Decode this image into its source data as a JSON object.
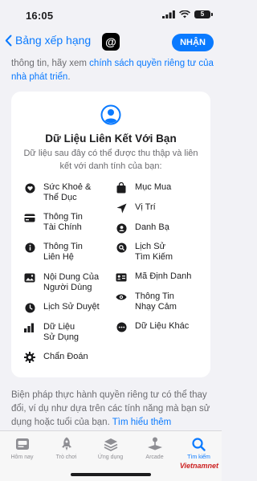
{
  "status": {
    "time": "16:05",
    "battery": "5"
  },
  "nav": {
    "back_label": "Bảng xếp hạng",
    "app_icon_glyph": "@",
    "open_label": "NHẬN"
  },
  "intro": {
    "text": "thông tin, hãy xem ",
    "link": "chính sách quyền riêng tư của nhà phát triển",
    "end": "."
  },
  "card": {
    "title": "Dữ Liệu Liên Kết Với Bạn",
    "subtitle": "Dữ liệu sau đây có thể được thu thập và liên kết với danh tính của bạn:",
    "left_items": [
      {
        "icon": "heart-icon",
        "label": "Sức Khoẻ &\nThể Dục"
      },
      {
        "icon": "credit-card-icon",
        "label": "Thông Tin\nTài Chính"
      },
      {
        "icon": "info-icon",
        "label": "Thông Tin\nLiên Hệ"
      },
      {
        "icon": "photo-icon",
        "label": "Nội Dung Của\nNgười Dùng"
      },
      {
        "icon": "clock-icon",
        "label": "Lịch Sử Duyệt"
      },
      {
        "icon": "chart-icon",
        "label": "Dữ Liệu\nSử Dụng"
      },
      {
        "icon": "gear-icon",
        "label": "Chẩn Đoán"
      }
    ],
    "right_items": [
      {
        "icon": "bag-icon",
        "label": "Mục Mua"
      },
      {
        "icon": "location-icon",
        "label": "Vị Trí"
      },
      {
        "icon": "contacts-icon",
        "label": "Danh Bạ"
      },
      {
        "icon": "search-icon",
        "label": "Lịch Sử\nTìm Kiếm"
      },
      {
        "icon": "id-card-icon",
        "label": "Mã Định Danh"
      },
      {
        "icon": "eye-icon",
        "label": "Thông Tin\nNhạy Cảm"
      },
      {
        "icon": "more-icon",
        "label": "Dữ Liệu Khác"
      }
    ]
  },
  "footer": {
    "text": "Biện pháp thực hành quyền riêng tư có thể thay đổi, ví dụ như dựa trên các tính năng mà bạn sử dụng hoặc tuổi của bạn. ",
    "link": "Tìm hiểu thêm"
  },
  "tabs": [
    {
      "label": "Hôm nay",
      "icon": "today-icon"
    },
    {
      "label": "Trò chơi",
      "icon": "rocket-icon"
    },
    {
      "label": "Ứng dụng",
      "icon": "stack-icon"
    },
    {
      "label": "Arcade",
      "icon": "joystick-icon"
    },
    {
      "label": "Tìm kiếm",
      "icon": "search-icon",
      "active": true
    }
  ],
  "watermark": "Vietnamnet",
  "colors": {
    "accent": "#0a7aff",
    "background": "#f2f2f6"
  }
}
